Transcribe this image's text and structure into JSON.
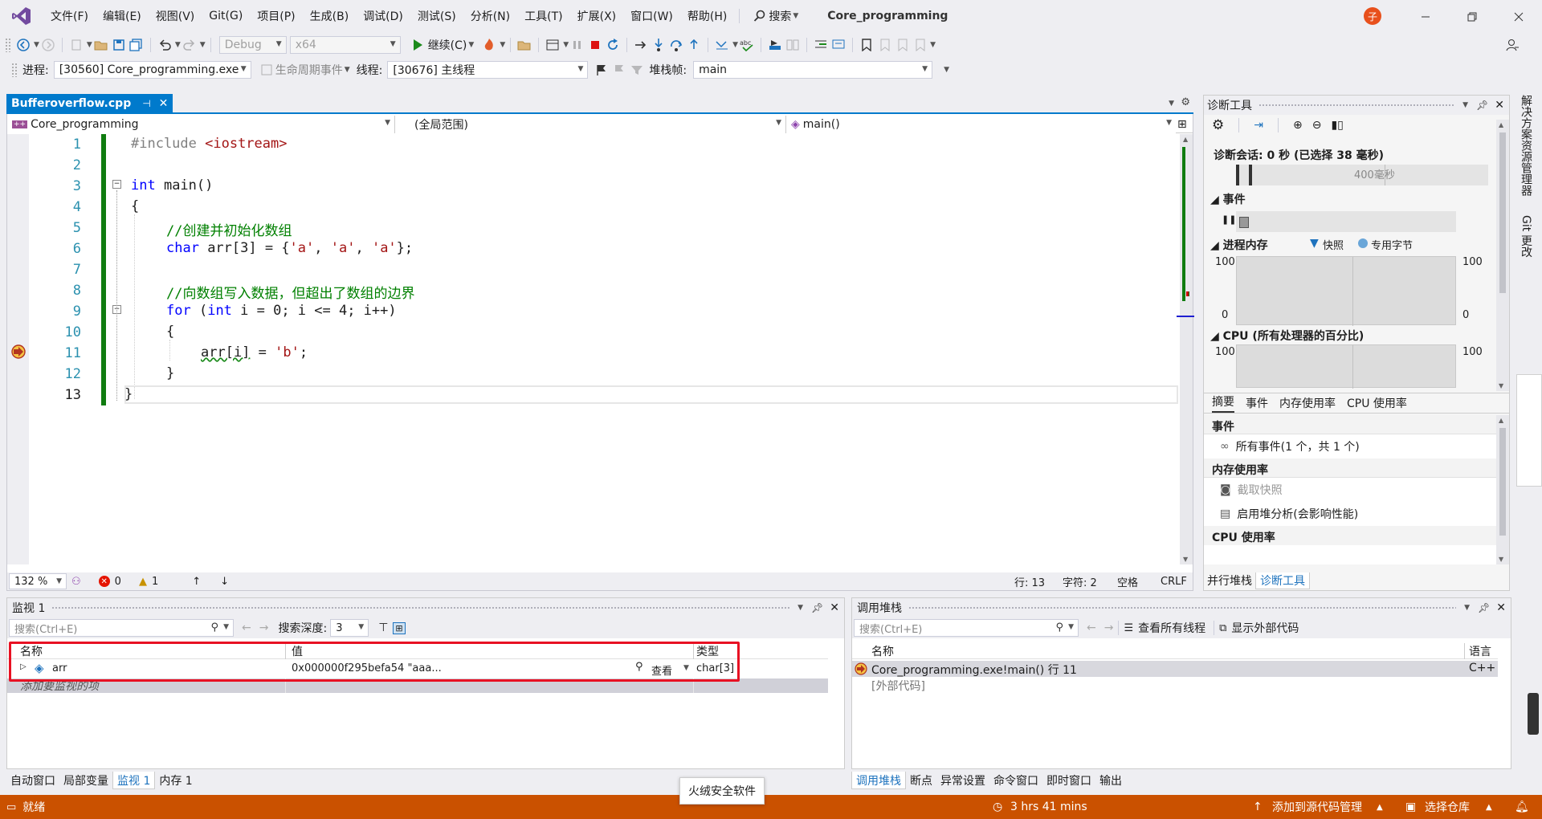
{
  "menu": {
    "items": [
      "文件(F)",
      "编辑(E)",
      "视图(V)",
      "Git(G)",
      "项目(P)",
      "生成(B)",
      "调试(D)",
      "测试(S)",
      "分析(N)",
      "工具(T)",
      "扩展(X)",
      "窗口(W)",
      "帮助(H)"
    ],
    "search": "搜索",
    "solution_title": "Core_programming",
    "avatar": "子"
  },
  "toolbar": {
    "config": "Debug",
    "platform": "x64",
    "continue": "继续(C)"
  },
  "debug_location": {
    "process_label": "进程:",
    "process_value": "[30560] Core_programming.exe",
    "lifecycle": "生命周期事件",
    "thread_label": "线程:",
    "thread_value": "[30676] 主线程",
    "stack_label": "堆栈帧:",
    "stack_value": "main"
  },
  "editor": {
    "tab_title": "Bufferoverflow.cpp",
    "nav_project": "Core_programming",
    "nav_scope": "(全局范围)",
    "nav_member": "main()",
    "lines": [
      "1",
      "2",
      "3",
      "4",
      "5",
      "6",
      "7",
      "8",
      "9",
      "10",
      "11",
      "12",
      "13"
    ],
    "code": {
      "l1_pp": "#include ",
      "l1_hdr": "<iostream>",
      "l3_kw": "int",
      "l3_rest": " main()",
      "l4": "{",
      "l5": "//创建并初始化数组",
      "l6_kw": "char",
      "l6_a": " arr[3] = {",
      "l6_s1": "'a'",
      "l6_c1": ", ",
      "l6_s2": "'a'",
      "l6_c2": ", ",
      "l6_s3": "'a'",
      "l6_end": "};",
      "l8": "//向数组写入数据，但超出了数组的边界",
      "l9_kw": "for",
      "l9_a": " (",
      "l9_kw2": "int",
      "l9_b": " i = 0; i <= 4; i++)",
      "l10": "{",
      "l11_a": "arr[i]",
      "l11_b": " = ",
      "l11_s": "'b'",
      "l11_c": ";",
      "l12": "}",
      "l13": "}"
    },
    "status": {
      "zoom": "132 %",
      "errors": "0",
      "warnings": "1",
      "line": "行: 13",
      "col": "字符: 2",
      "spacing": "空格",
      "eol": "CRLF"
    }
  },
  "diagnostics": {
    "title": "诊断工具",
    "session": "诊断会话: 0 秒 (已选择 38 毫秒)",
    "time_marker": "400毫秒",
    "events_label": "事件",
    "memory_label": "进程内存",
    "snapshot_legend": "快照",
    "private_bytes_legend": "专用字节",
    "mem_top_left": "100",
    "mem_top_right": "100",
    "mem_bottom_left": "0",
    "mem_bottom_right": "0",
    "cpu_label": "CPU (所有处理器的百分比)",
    "cpu_top_left": "100",
    "cpu_top_right": "100",
    "tabs": [
      "摘要",
      "事件",
      "内存使用率",
      "CPU 使用率"
    ],
    "sec_events": "事件",
    "all_events": "所有事件(1 个，共 1 个)",
    "sec_memory": "内存使用率",
    "take_snapshot": "截取快照",
    "heap_profiling": "启用堆分析(会影响性能)",
    "sec_cpu": "CPU 使用率",
    "bottom_tabs": [
      "并行堆栈",
      "诊断工具"
    ]
  },
  "right_rail": [
    "解决方案资源管理器",
    "Git 更改"
  ],
  "watch": {
    "title": "监视 1",
    "search_placeholder": "搜索(Ctrl+E)",
    "depth_label": "搜索深度:",
    "depth_value": "3",
    "headers": {
      "name": "名称",
      "value": "值",
      "type": "类型"
    },
    "row": {
      "name": "arr",
      "value": "0x000000f295befa54 \"aaa...",
      "view": "查看",
      "type": "char[3]"
    },
    "add_item": "添加要监视的项",
    "bottom_tabs": [
      "自动窗口",
      "局部变量",
      "监视 1",
      "内存 1"
    ]
  },
  "callstack": {
    "title": "调用堆栈",
    "search_placeholder": "搜索(Ctrl+E)",
    "show_threads": "查看所有线程",
    "show_external": "显示外部代码",
    "headers": {
      "name": "名称",
      "lang": "语言"
    },
    "rows": [
      {
        "name": "Core_programming.exe!main() 行 11",
        "lang": "C++"
      },
      {
        "name": "[外部代码]",
        "lang": ""
      }
    ],
    "bottom_tabs": [
      "调用堆栈",
      "断点",
      "异常设置",
      "命令窗口",
      "即时窗口",
      "输出"
    ]
  },
  "tooltip": "火绒安全软件",
  "statusbar": {
    "ready": "就绪",
    "time": "3 hrs 41 mins",
    "source_control": "添加到源代码管理",
    "repo": "选择仓库"
  },
  "colors": {
    "accent": "#007acc",
    "statusbar": "#ca5100",
    "highlight_box": "#e81123",
    "change_bar": "#107c10"
  }
}
